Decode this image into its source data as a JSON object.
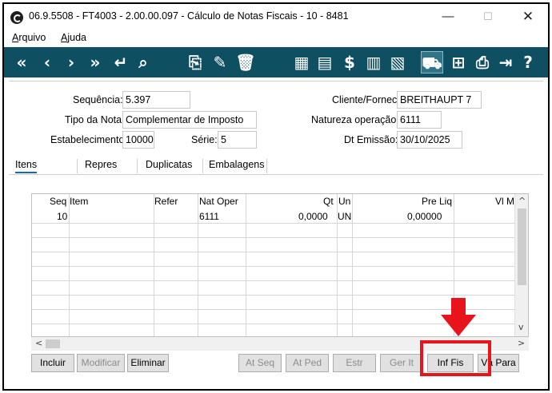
{
  "window": {
    "title": "06.9.5508 - FT4003 - 2.00.00.097 - Cálculo de Notas Fiscais - 10 - 8481",
    "controls": {
      "minimize": "—",
      "maximize": "☐",
      "close": "✕"
    }
  },
  "menu": {
    "arquivo": "Arquivo",
    "ajuda": "Ajuda"
  },
  "toolbar": {
    "icons": [
      "first-icon",
      "previous-icon",
      "next-icon",
      "last-icon",
      "return-icon",
      "search-icon",
      "new-icon",
      "edit-icon",
      "delete-icon",
      "calculator-icon",
      "report-icon",
      "dollar-icon",
      "book-icon",
      "document-icon",
      "truck-icon",
      "tree-icon",
      "print-icon",
      "exit-icon",
      "help-icon"
    ],
    "active": "truck-icon",
    "color": "#0e4f62"
  },
  "form": {
    "sequencia": {
      "label": "Sequência:",
      "value": "5.397"
    },
    "tipo_nota": {
      "label": "Tipo da Nota:",
      "value": "Complementar de Imposto"
    },
    "estabelecimento": {
      "label": "Estabelecimento:",
      "value": "10000"
    },
    "serie": {
      "label": "Série:",
      "value": "5"
    },
    "cliente": {
      "label": "Cliente/Fornec:",
      "value": "BREITHAUPT 7"
    },
    "natureza": {
      "label": "Natureza operação:",
      "value": "6111"
    },
    "dt_emissao": {
      "label": "Dt Emissão:",
      "value": "30/10/2025"
    }
  },
  "tabs": [
    "Itens",
    "Repres",
    "Duplicatas",
    "Embalagens"
  ],
  "grid": {
    "columns": [
      "Seq",
      "Item",
      "Refer",
      "Nat Oper",
      "Qt",
      "Un",
      "Pre Liq",
      "Vl M"
    ],
    "rows": [
      {
        "seq": "10",
        "item": "",
        "refer": "",
        "nat_oper": "6111",
        "qt": "0,0000",
        "un": "UN",
        "pre_liq": "0,00000",
        "vl_m": ""
      }
    ]
  },
  "buttons": {
    "incluir": "Incluir",
    "modificar": "Modificar",
    "eliminar": "Eliminar",
    "at_seq": "At Seq",
    "at_ped": "At Ped",
    "estr": "Estr",
    "ger_it": "Ger It",
    "inf_fis": "Inf Fis",
    "vai_para": "Vá Para"
  },
  "annotation": {
    "highlight_color": "#e8131b"
  }
}
